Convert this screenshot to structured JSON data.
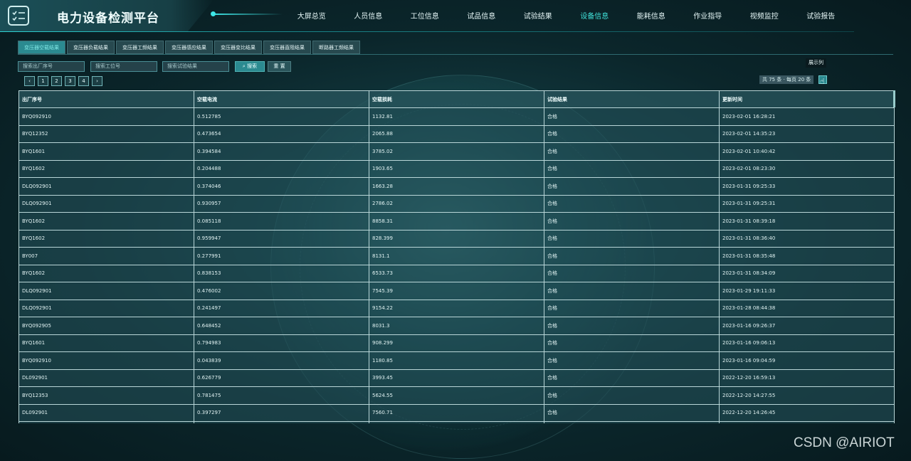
{
  "app": {
    "title": "电力设备检测平台",
    "logo_icon": "checklist-icon"
  },
  "nav": {
    "items": [
      {
        "label": "大屏总览",
        "active": false
      },
      {
        "label": "人员信息",
        "active": false
      },
      {
        "label": "工位信息",
        "active": false
      },
      {
        "label": "试品信息",
        "active": false
      },
      {
        "label": "试验结果",
        "active": false
      },
      {
        "label": "设备信息",
        "active": true
      },
      {
        "label": "能耗信息",
        "active": false
      },
      {
        "label": "作业指导",
        "active": false
      },
      {
        "label": "视频监控",
        "active": false
      },
      {
        "label": "试验报告",
        "active": false
      }
    ]
  },
  "tabs": [
    {
      "label": "变压器空载结果",
      "active": true
    },
    {
      "label": "变压器负载结果",
      "active": false
    },
    {
      "label": "变压器工频结果",
      "active": false
    },
    {
      "label": "变压器感应结果",
      "active": false
    },
    {
      "label": "变压器变比结果",
      "active": false
    },
    {
      "label": "变压器直阻结果",
      "active": false
    },
    {
      "label": "断路器工频结果",
      "active": false
    }
  ],
  "filters": {
    "serial_placeholder": "搜索出厂序号",
    "station_placeholder": "搜索工位号",
    "result_placeholder": "搜索试验结果",
    "search_label": "搜索",
    "reset_label": "重 置"
  },
  "pagination": {
    "pages": [
      "1",
      "2",
      "3",
      "4"
    ],
    "summary": "共 75 条 · 每页 20 条",
    "columns_tooltip": "展示列"
  },
  "table": {
    "headers": [
      "出厂序号",
      "空载电流",
      "空载损耗",
      "试验结果",
      "更新时间"
    ],
    "rows": [
      [
        "BYQ092910",
        "0.512785",
        "1132.81",
        "合格",
        "2023-02-01 16:28:21"
      ],
      [
        "BYQ12352",
        "0.473654",
        "2065.88",
        "合格",
        "2023-02-01 14:35:23"
      ],
      [
        "BYQ1601",
        "0.394584",
        "3785.02",
        "合格",
        "2023-02-01 10:40:42"
      ],
      [
        "BYQ1602",
        "0.204488",
        "1903.65",
        "合格",
        "2023-02-01 08:23:30"
      ],
      [
        "DLQ092901",
        "0.374046",
        "1663.28",
        "合格",
        "2023-01-31 09:25:33"
      ],
      [
        "DLQ092901",
        "0.930957",
        "2786.02",
        "合格",
        "2023-01-31 09:25:31"
      ],
      [
        "BYQ1602",
        "0.085118",
        "8858.31",
        "合格",
        "2023-01-31 08:39:18"
      ],
      [
        "BYQ1602",
        "0.959947",
        "828.399",
        "合格",
        "2023-01-31 08:36:40"
      ],
      [
        "BY007",
        "0.277991",
        "8131.1",
        "合格",
        "2023-01-31 08:35:48"
      ],
      [
        "BYQ1602",
        "0.838153",
        "6533.73",
        "合格",
        "2023-01-31 08:34:09"
      ],
      [
        "DLQ092901",
        "0.476002",
        "7545.39",
        "合格",
        "2023-01-29 19:11:33"
      ],
      [
        "DLQ092901",
        "0.241497",
        "9154.22",
        "合格",
        "2023-01-28 08:44:38"
      ],
      [
        "BYQ092905",
        "0.648452",
        "8031.3",
        "合格",
        "2023-01-16 09:26:37"
      ],
      [
        "BYQ1601",
        "0.794983",
        "908.299",
        "合格",
        "2023-01-16 09:06:13"
      ],
      [
        "BYQ092910",
        "0.043839",
        "1180.85",
        "合格",
        "2023-01-16 09:04:59"
      ],
      [
        "DL092901",
        "0.626779",
        "3993.45",
        "合格",
        "2022-12-20 16:59:13"
      ],
      [
        "BYQ12353",
        "0.781475",
        "5624.55",
        "合格",
        "2022-12-20 14:27:55"
      ],
      [
        "DL092901",
        "0.397297",
        "7560.71",
        "合格",
        "2022-12-20 14:26:45"
      ],
      [
        "",
        "",
        "",
        "",
        ""
      ]
    ]
  },
  "watermark": "CSDN @AIRIOT",
  "colors": {
    "accent": "#40e0d8",
    "button": "#2b8a90",
    "background": "#0b262b"
  }
}
